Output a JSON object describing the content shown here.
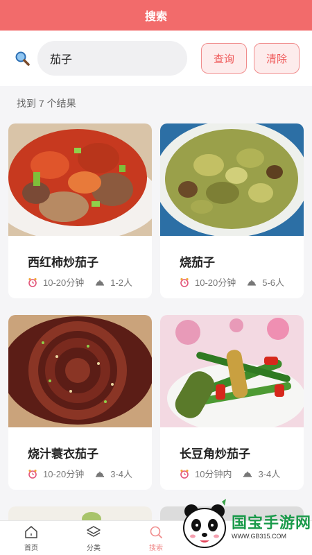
{
  "header": {
    "title": "搜索"
  },
  "search": {
    "value": "茄子",
    "query_button": "查询",
    "clear_button": "清除"
  },
  "results": {
    "summary": "找到 7 个结果",
    "items": [
      {
        "title": "西红柿炒茄子",
        "time": "10-20分钟",
        "servings": "1-2人"
      },
      {
        "title": "烧茄子",
        "time": "10-20分钟",
        "servings": "5-6人"
      },
      {
        "title": "烧汁蓑衣茄子",
        "time": "10-20分钟",
        "servings": "3-4人"
      },
      {
        "title": "长豆角炒茄子",
        "time": "10分钟内",
        "servings": "3-4人"
      }
    ]
  },
  "tabs": [
    {
      "label": "首页",
      "icon": "home-icon"
    },
    {
      "label": "分类",
      "icon": "layers-icon"
    },
    {
      "label": "搜索",
      "icon": "search-icon"
    }
  ],
  "watermark": {
    "main": "国宝手游网",
    "sub": "WWW.GB315.COM"
  },
  "colors": {
    "accent": "#f26b6b",
    "button_border": "#f08c8c",
    "watermark": "#1a9a4a"
  }
}
